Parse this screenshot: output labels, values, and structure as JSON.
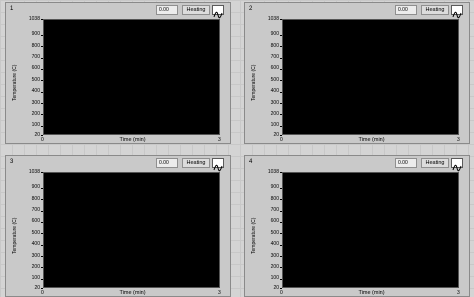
{
  "panels": [
    {
      "number": "1",
      "value": "0.00",
      "mode": "Heating",
      "ylabel": "Temperature (C)",
      "xlabel": "Time (min)",
      "y_ticks": [
        "1038",
        "900",
        "800",
        "700",
        "600",
        "500",
        "400",
        "300",
        "200",
        "100",
        "20"
      ],
      "x_ticks": [
        "0",
        "3"
      ]
    },
    {
      "number": "2",
      "value": "0.00",
      "mode": "Heating",
      "ylabel": "Temperature (C)",
      "xlabel": "Time (min)",
      "y_ticks": [
        "1038",
        "900",
        "800",
        "700",
        "600",
        "500",
        "400",
        "300",
        "200",
        "100",
        "20"
      ],
      "x_ticks": [
        "0",
        "3"
      ]
    },
    {
      "number": "3",
      "value": "0.00",
      "mode": "Heating",
      "ylabel": "Temperature (C)",
      "xlabel": "Time (min)",
      "y_ticks": [
        "1038",
        "900",
        "800",
        "700",
        "600",
        "500",
        "400",
        "300",
        "200",
        "100",
        "20"
      ],
      "x_ticks": [
        "0",
        "3"
      ]
    },
    {
      "number": "4",
      "value": "0.00",
      "mode": "Heating",
      "ylabel": "Temperature (C)",
      "xlabel": "Time (min)",
      "y_ticks": [
        "1038",
        "900",
        "800",
        "700",
        "600",
        "500",
        "400",
        "300",
        "200",
        "100",
        "20"
      ],
      "x_ticks": [
        "0",
        "3"
      ]
    }
  ],
  "icons": {
    "mode_button": "waveform-icon"
  }
}
